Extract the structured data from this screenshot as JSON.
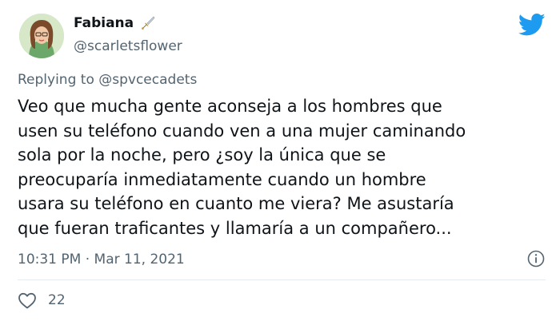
{
  "author": {
    "display_name": "Fabiana",
    "handle": "@scarletsflower",
    "badge_emoji": "dagger-emoji",
    "avatar": "avatar-illustration"
  },
  "reply": {
    "prefix": "Replying to ",
    "mention": "@spvcecadets"
  },
  "tweet": {
    "text": "Veo que mucha gente aconseja a los hombres que\nusen su teléfono cuando ven a una mujer caminando\nsola por la noche, pero ¿soy la única que se\npreocuparía inmediatamente cuando un hombre\nusara su teléfono en cuanto me viera? Me asustaría\nque fueran traficantes y llamaría a un compañero..."
  },
  "meta": {
    "timestamp": "10:31 PM · Mar 11, 2021"
  },
  "actions": {
    "likes": "22"
  },
  "icons": {
    "brand": "twitter-bird-icon",
    "info": "info-icon",
    "like": "heart-icon"
  },
  "colors": {
    "twitter_blue": "#1d9bf0",
    "secondary_text": "#536471",
    "primary_text": "#0f1419"
  }
}
